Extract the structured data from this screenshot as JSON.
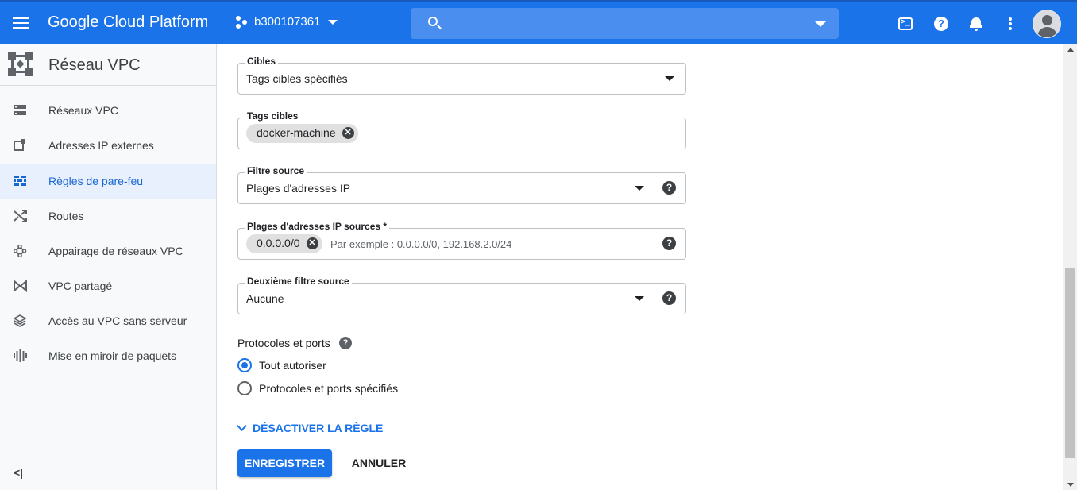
{
  "header": {
    "brand": "Google Cloud Platform",
    "project": "b300107361",
    "search_placeholder": "",
    "accent_color": "#1a73e8"
  },
  "icons": {
    "menu": "menu-icon",
    "project": "project-dots-icon",
    "search": "search-icon",
    "terminal": "cloud-shell-icon",
    "help": "help-icon",
    "notifications": "bell-icon",
    "more": "more-vert-icon",
    "account": "avatar-icon"
  },
  "help_glyph": "?",
  "chip_remove_glyph": "✕",
  "sidebar": {
    "title": "Réseau VPC",
    "items": [
      {
        "label": "Réseaux VPC",
        "icon": "vpc-networks-icon"
      },
      {
        "label": "Adresses IP externes",
        "icon": "external-ip-icon"
      },
      {
        "label": "Règles de pare-feu",
        "icon": "firewall-icon",
        "active": true
      },
      {
        "label": "Routes",
        "icon": "routes-icon"
      },
      {
        "label": "Appairage de réseaux VPC",
        "icon": "peering-icon"
      },
      {
        "label": "VPC partagé",
        "icon": "shared-vpc-icon"
      },
      {
        "label": "Accès au VPC sans serveur",
        "icon": "serverless-access-icon"
      },
      {
        "label": "Mise en miroir de paquets",
        "icon": "packet-mirroring-icon"
      }
    ],
    "collapse_label": "<|"
  },
  "form": {
    "targets": {
      "label": "Cibles",
      "value": "Tags cibles spécifiés"
    },
    "target_tags": {
      "label": "Tags cibles",
      "chips": [
        "docker-machine"
      ]
    },
    "source_filter": {
      "label": "Filtre source",
      "value": "Plages d'adresses IP"
    },
    "source_ranges": {
      "label": "Plages d'adresses IP sources *",
      "chips": [
        "0.0.0.0/0"
      ],
      "placeholder": "Par exemple : 0.0.0.0/0, 192.168.2.0/24"
    },
    "second_source_filter": {
      "label": "Deuxième filtre source",
      "value": "Aucune"
    },
    "protocols": {
      "heading": "Protocoles et ports",
      "options": [
        {
          "label": "Tout autoriser",
          "selected": true
        },
        {
          "label": "Protocoles et ports spécifiés",
          "selected": false
        }
      ]
    },
    "disable_rule": "DÉSACTIVER LA RÈGLE",
    "save": "ENREGISTRER",
    "cancel": "ANNULER"
  }
}
